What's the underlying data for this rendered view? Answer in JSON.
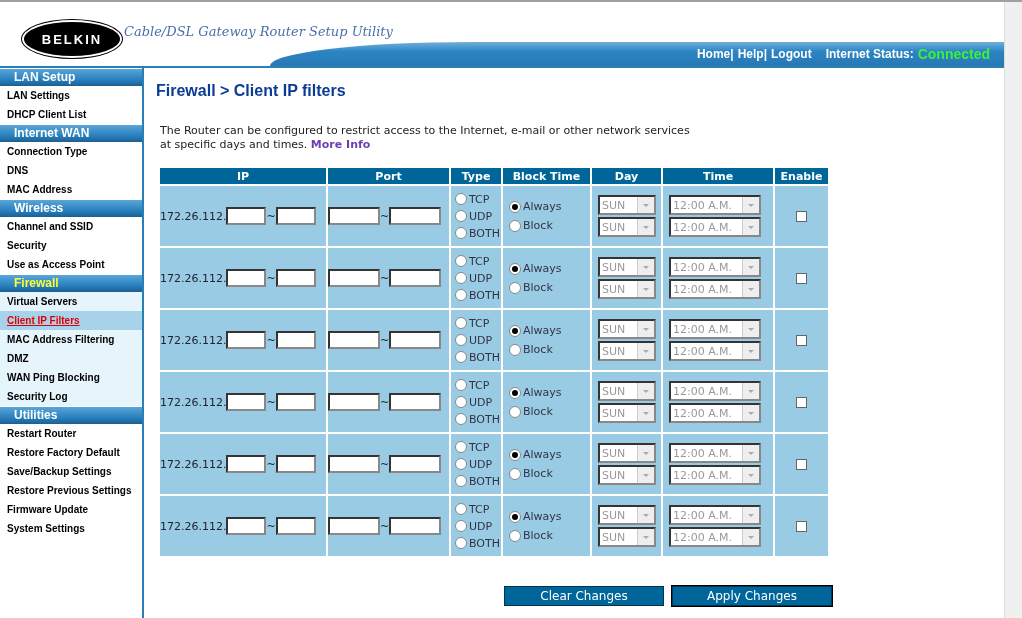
{
  "header": {
    "logo": "BELKIN",
    "tagline": "Cable/DSL Gateway Router Setup Utility",
    "nav_links": [
      "Home|",
      "Help|",
      "Logout"
    ],
    "status_label": "Internet Status:",
    "status_value": "Connected"
  },
  "sidebar": [
    {
      "title": "LAN Setup",
      "selected": false,
      "items": [
        {
          "label": "LAN Settings",
          "selected": false
        },
        {
          "label": "DHCP Client List",
          "selected": false
        }
      ]
    },
    {
      "title": "Internet WAN",
      "selected": false,
      "items": [
        {
          "label": "Connection Type",
          "selected": false
        },
        {
          "label": "DNS",
          "selected": false
        },
        {
          "label": "MAC Address",
          "selected": false
        }
      ]
    },
    {
      "title": "Wireless",
      "selected": false,
      "items": [
        {
          "label": "Channel and SSID",
          "selected": false
        },
        {
          "label": "Security",
          "selected": false
        },
        {
          "label": "Use as Access Point",
          "selected": false
        }
      ]
    },
    {
      "title": "Firewall",
      "selected": true,
      "items": [
        {
          "label": "Virtual Servers",
          "selected": false
        },
        {
          "label": "Client IP Filters",
          "selected": true
        },
        {
          "label": "MAC Address Filtering",
          "selected": false
        },
        {
          "label": "DMZ",
          "selected": false
        },
        {
          "label": "WAN Ping Blocking",
          "selected": false
        },
        {
          "label": "Security Log",
          "selected": false
        }
      ]
    },
    {
      "title": "Utilities",
      "selected": false,
      "items": [
        {
          "label": "Restart Router",
          "selected": false
        },
        {
          "label": "Restore Factory Default",
          "selected": false
        },
        {
          "label": "Save/Backup Settings",
          "selected": false
        },
        {
          "label": "Restore Previous Settings",
          "selected": false
        },
        {
          "label": "Firmware Update",
          "selected": false
        },
        {
          "label": "System Settings",
          "selected": false
        }
      ]
    }
  ],
  "page_title": "Firewall > Client IP filters",
  "description": "The Router can be configured to restrict access to the Internet, e-mail or other network services at specific days and times.",
  "more_info_link": "More Info",
  "table": {
    "columns": [
      "IP",
      "Port",
      "Type",
      "Block Time",
      "Day",
      "Time",
      "Enable"
    ],
    "rows": [
      {
        "ip_prefix": "172.26.112.",
        "separator": "~",
        "types": [
          {
            "label": "TCP",
            "selected": false
          },
          {
            "label": "UDP",
            "selected": false
          },
          {
            "label": "BOTH",
            "selected": false
          }
        ],
        "block_time": [
          {
            "label": "Always",
            "selected": true
          },
          {
            "label": "Block",
            "selected": false
          }
        ],
        "days": [
          "SUN",
          "SUN"
        ],
        "times": [
          "12:00 A.M.",
          "12:00 A.M."
        ],
        "schedule_disabled": true,
        "enabled": false
      },
      {
        "ip_prefix": "172.26.112.",
        "separator": "~",
        "types": [
          {
            "label": "TCP",
            "selected": false
          },
          {
            "label": "UDP",
            "selected": false
          },
          {
            "label": "BOTH",
            "selected": false
          }
        ],
        "block_time": [
          {
            "label": "Always",
            "selected": true
          },
          {
            "label": "Block",
            "selected": false
          }
        ],
        "days": [
          "SUN",
          "SUN"
        ],
        "times": [
          "12:00 A.M.",
          "12:00 A.M."
        ],
        "schedule_disabled": true,
        "enabled": false
      },
      {
        "ip_prefix": "172.26.112.",
        "separator": "~",
        "types": [
          {
            "label": "TCP",
            "selected": false
          },
          {
            "label": "UDP",
            "selected": false
          },
          {
            "label": "BOTH",
            "selected": false
          }
        ],
        "block_time": [
          {
            "label": "Always",
            "selected": true
          },
          {
            "label": "Block",
            "selected": false
          }
        ],
        "days": [
          "SUN",
          "SUN"
        ],
        "times": [
          "12:00 A.M.",
          "12:00 A.M."
        ],
        "schedule_disabled": true,
        "enabled": false
      },
      {
        "ip_prefix": "172.26.112.",
        "separator": "~",
        "types": [
          {
            "label": "TCP",
            "selected": false
          },
          {
            "label": "UDP",
            "selected": false
          },
          {
            "label": "BOTH",
            "selected": false
          }
        ],
        "block_time": [
          {
            "label": "Always",
            "selected": true
          },
          {
            "label": "Block",
            "selected": false
          }
        ],
        "days": [
          "SUN",
          "SUN"
        ],
        "times": [
          "12:00 A.M.",
          "12:00 A.M."
        ],
        "schedule_disabled": true,
        "enabled": false
      },
      {
        "ip_prefix": "172.26.112.",
        "separator": "~",
        "types": [
          {
            "label": "TCP",
            "selected": false
          },
          {
            "label": "UDP",
            "selected": false
          },
          {
            "label": "BOTH",
            "selected": false
          }
        ],
        "block_time": [
          {
            "label": "Always",
            "selected": true
          },
          {
            "label": "Block",
            "selected": false
          }
        ],
        "days": [
          "SUN",
          "SUN"
        ],
        "times": [
          "12:00 A.M.",
          "12:00 A.M."
        ],
        "schedule_disabled": true,
        "enabled": false
      },
      {
        "ip_prefix": "172.26.112.",
        "separator": "~",
        "types": [
          {
            "label": "TCP",
            "selected": false
          },
          {
            "label": "UDP",
            "selected": false
          },
          {
            "label": "BOTH",
            "selected": false
          }
        ],
        "block_time": [
          {
            "label": "Always",
            "selected": true
          },
          {
            "label": "Block",
            "selected": false
          }
        ],
        "days": [
          "SUN",
          "SUN"
        ],
        "times": [
          "12:00 A.M.",
          "12:00 A.M."
        ],
        "schedule_disabled": true,
        "enabled": false
      }
    ]
  },
  "buttons": [
    "Clear Changes",
    "Apply Changes"
  ]
}
